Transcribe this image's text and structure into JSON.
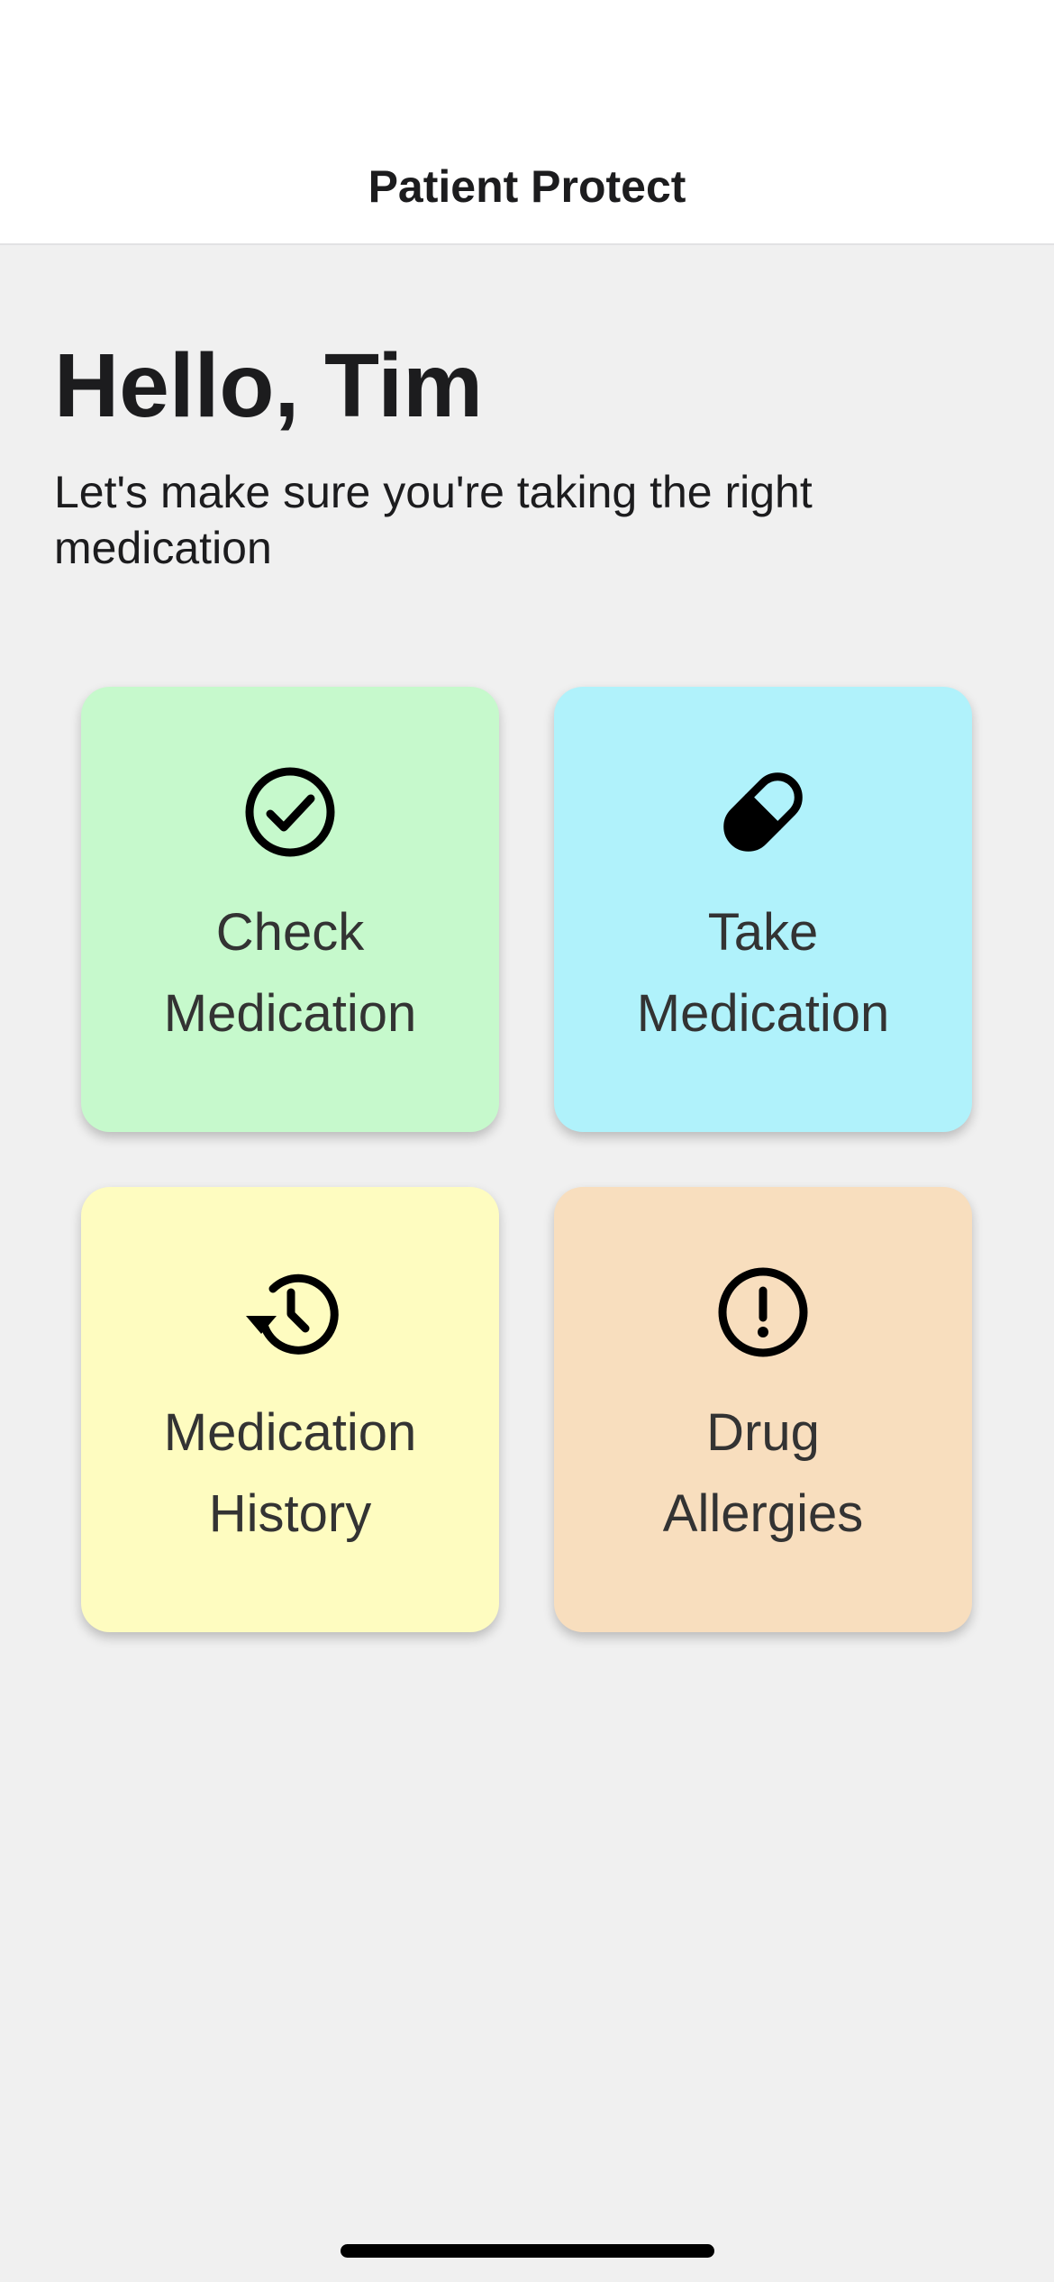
{
  "header": {
    "title": "Patient Protect"
  },
  "main": {
    "greeting": "Hello, Tim",
    "subtitle": "Let's make sure you're taking the right medication"
  },
  "tiles": [
    {
      "line1": "Check",
      "line2": "Medication",
      "icon": "check-circle-icon",
      "color": "#c6f9cc"
    },
    {
      "line1": "Take",
      "line2": "Medication",
      "icon": "pill-icon",
      "color": "#b0f2fb"
    },
    {
      "line1": "Medication",
      "line2": "History",
      "icon": "history-icon",
      "color": "#fefcc0"
    },
    {
      "line1": "Drug",
      "line2": "Allergies",
      "icon": "alert-circle-icon",
      "color": "#f8debe"
    }
  ]
}
